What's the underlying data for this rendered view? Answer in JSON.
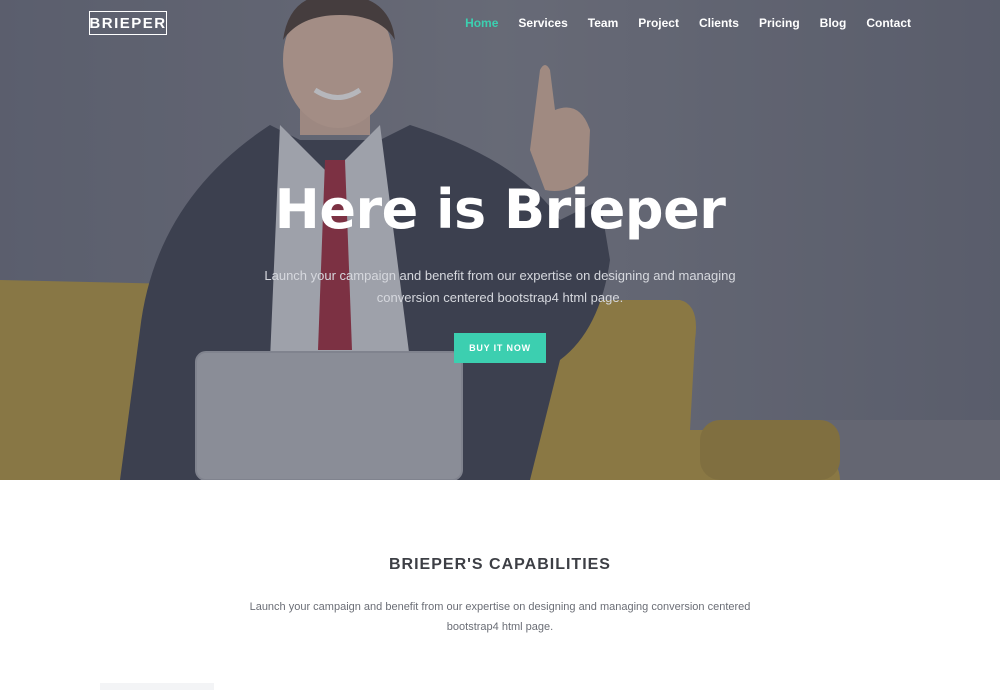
{
  "nav": {
    "logo": "BRIEPER",
    "items": [
      {
        "label": "Home",
        "active": true
      },
      {
        "label": "Services"
      },
      {
        "label": "Team"
      },
      {
        "label": "Project"
      },
      {
        "label": "Clients"
      },
      {
        "label": "Pricing"
      },
      {
        "label": "Blog"
      },
      {
        "label": "Contact"
      }
    ]
  },
  "hero": {
    "title": "Here is Brieper",
    "subtitle_line1": "Launch your campaign and benefit from our expertise on designing and managing",
    "subtitle_line2": "conversion centered bootstrap4 html page.",
    "button": "BUY IT NOW"
  },
  "capabilities": {
    "title": "BRIEPER'S CAPABILITIES",
    "text_line1": "Launch your campaign and benefit from our expertise on designing and managing conversion centered",
    "text_line2": "bootstrap4 html page."
  },
  "colors": {
    "accent": "#3ccfb0",
    "hero_overlay": "#3e4250",
    "heading": "#3d3f45",
    "body_text": "#6b6e76"
  }
}
